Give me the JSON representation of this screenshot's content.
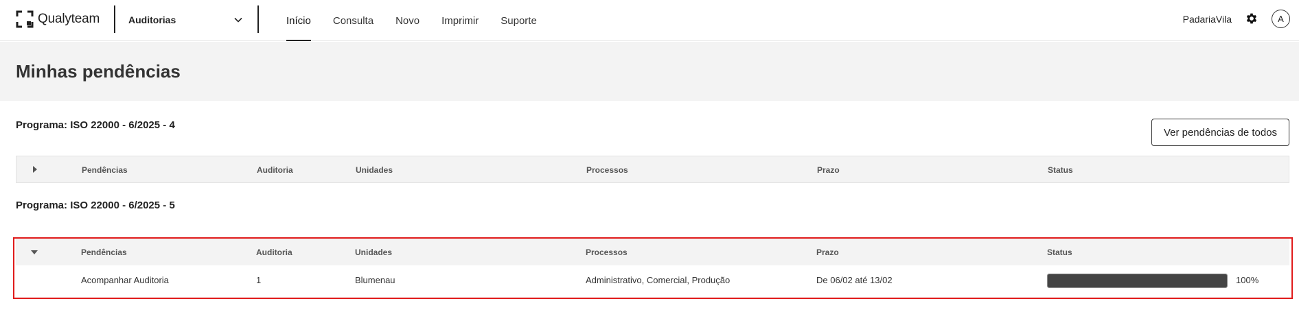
{
  "header": {
    "logo_text": "Qualyteam",
    "module": "Auditorias",
    "nav": [
      "Início",
      "Consulta",
      "Novo",
      "Imprimir",
      "Suporte"
    ],
    "active_nav": "Início",
    "organization": "PadariaVila",
    "avatar_initial": "A"
  },
  "page": {
    "title": "Minhas pendências",
    "view_all_button": "Ver pendências de todos"
  },
  "columns": [
    "Pendências",
    "Auditoria",
    "Unidades",
    "Processos",
    "Prazo",
    "Status"
  ],
  "programs": [
    {
      "title": "Programa: ISO 22000 - 6/2025 - 4",
      "expanded": false,
      "rows": []
    },
    {
      "title": "Programa: ISO 22000 - 6/2025 - 5",
      "expanded": true,
      "rows": [
        {
          "pendencia": "Acompanhar Auditoria",
          "auditoria": "1",
          "unidades": "Blumenau",
          "processos": "Administrativo, Comercial, Produção",
          "prazo": "De 06/02 até 13/02",
          "status_label": "100%",
          "status_progress": 1.0
        }
      ]
    }
  ],
  "colors": {
    "highlight": "#e01b1b",
    "progress": "#444444",
    "band": "#f3f3f3"
  }
}
